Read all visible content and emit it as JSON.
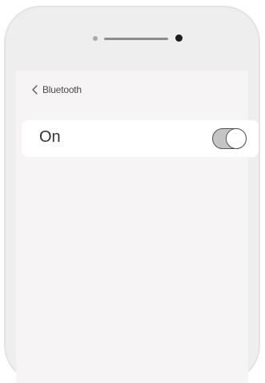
{
  "nav": {
    "back_icon": "chevron-left-icon",
    "back_label": "Bluetooth"
  },
  "bluetooth": {
    "label": "On",
    "enabled": true
  },
  "colors": {
    "screen_background": "#f6f4f4",
    "row_background": "#ffffff",
    "toggle_track": "#c4c4c4",
    "toggle_knob": "#ffffff",
    "phone_frame": "#eeeeee"
  }
}
